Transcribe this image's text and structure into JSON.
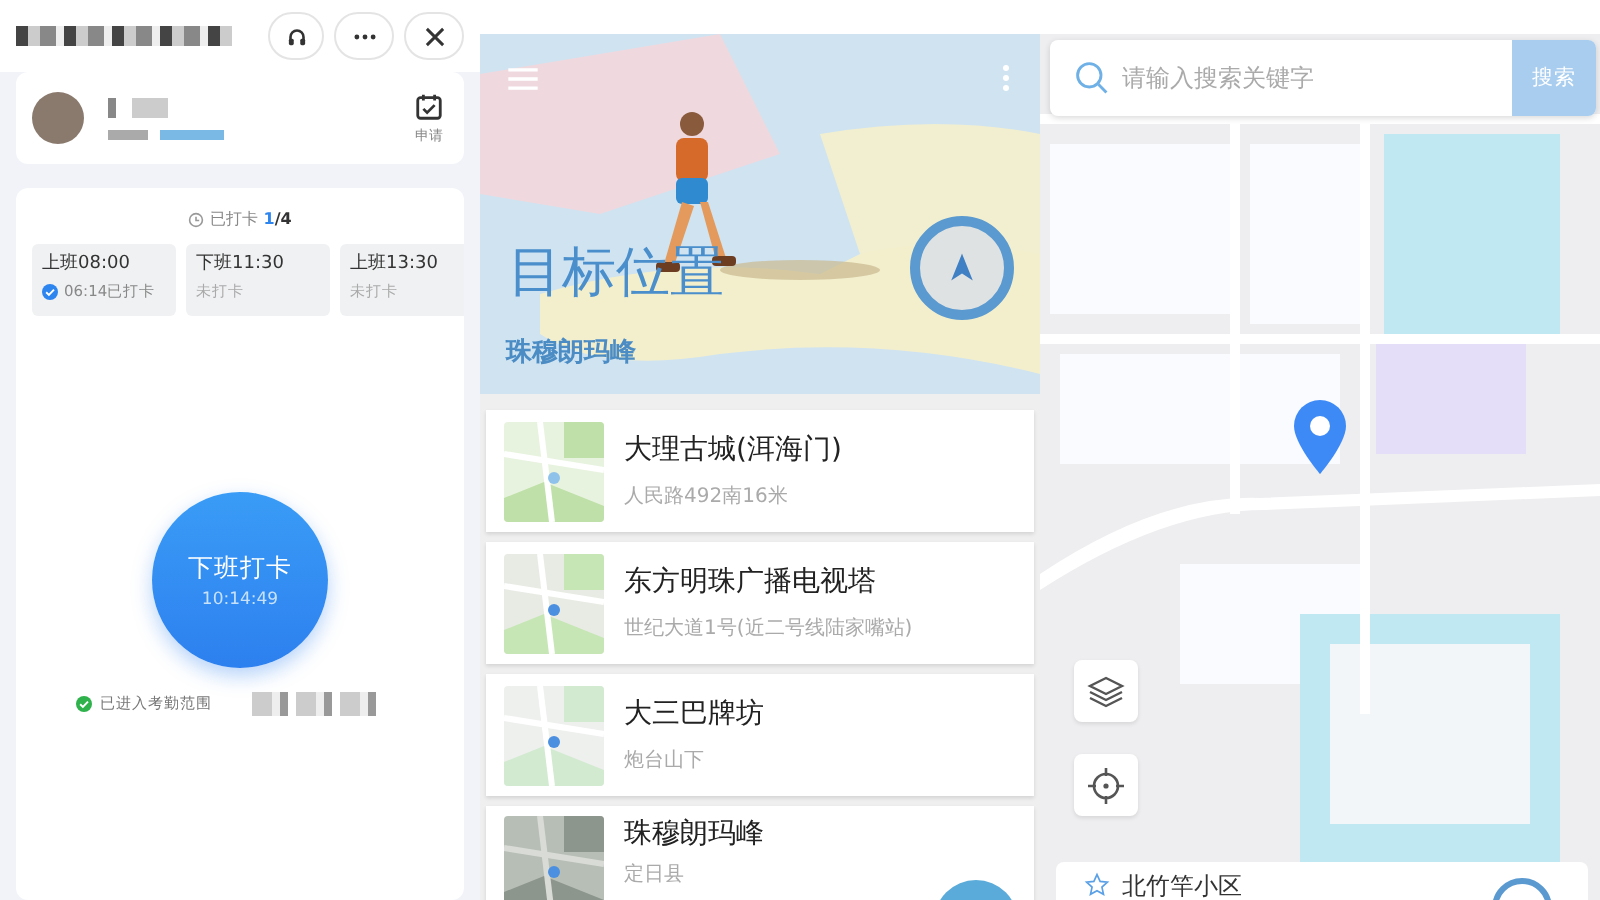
{
  "checkin": {
    "apply_label": "申请",
    "progress": {
      "label": "已打卡",
      "done": "1",
      "total": "/4"
    },
    "shifts": [
      {
        "title": "上班08:00",
        "status": "06:14已打卡",
        "checked": true
      },
      {
        "title": "下班11:30",
        "status": "未打卡",
        "checked": false
      },
      {
        "title": "上班13:30",
        "status": "未打卡",
        "checked": false
      }
    ],
    "punch_button": {
      "label": "下班打卡",
      "time": "10:14:49"
    },
    "range_status": {
      "text": "已进入考勤范围",
      "in_range": true
    }
  },
  "locations": {
    "hero": {
      "title": "目标位置",
      "subtitle": "珠穆朗玛峰"
    },
    "places": [
      {
        "name": "大理古城(洱海门)",
        "address": "人民路492南16米",
        "kind": "picture"
      },
      {
        "name": "东方明珠广播电视塔",
        "address": "世纪大道1号(近二号线陆家嘴站)",
        "kind": "picture"
      },
      {
        "name": "大三巴牌坊",
        "address": "炮台山下",
        "kind": "picture"
      },
      {
        "name": "珠穆朗玛峰",
        "address": "定日县",
        "kind": "picture"
      }
    ]
  },
  "map": {
    "search": {
      "placeholder": "请输入搜索关键字",
      "button": "搜索"
    },
    "selected_place": {
      "name": "北竹竿小区"
    }
  }
}
